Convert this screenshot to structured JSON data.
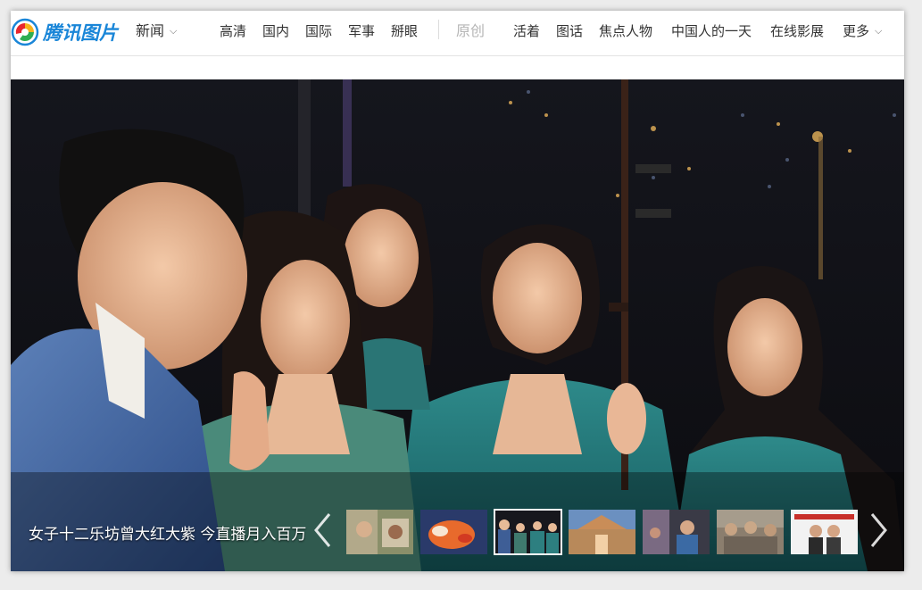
{
  "logo": {
    "text": "腾讯图片"
  },
  "nav": {
    "news": "新闻",
    "items": [
      "高清",
      "国内",
      "国际",
      "军事",
      "掰眼"
    ],
    "original": "原创",
    "right_items": [
      "活着",
      "图话",
      "焦点人物",
      "中国人的一天",
      "在线影展"
    ],
    "more": "更多"
  },
  "gallery": {
    "caption": "女子十二乐坊曾大红大紫 今直播月入百万",
    "active_index": 2
  },
  "icons": {
    "logo": "tencent-logo-icon",
    "nav_caret": "chevron-down-icon",
    "prev": "chevron-left-icon",
    "next": "chevron-right-icon"
  }
}
